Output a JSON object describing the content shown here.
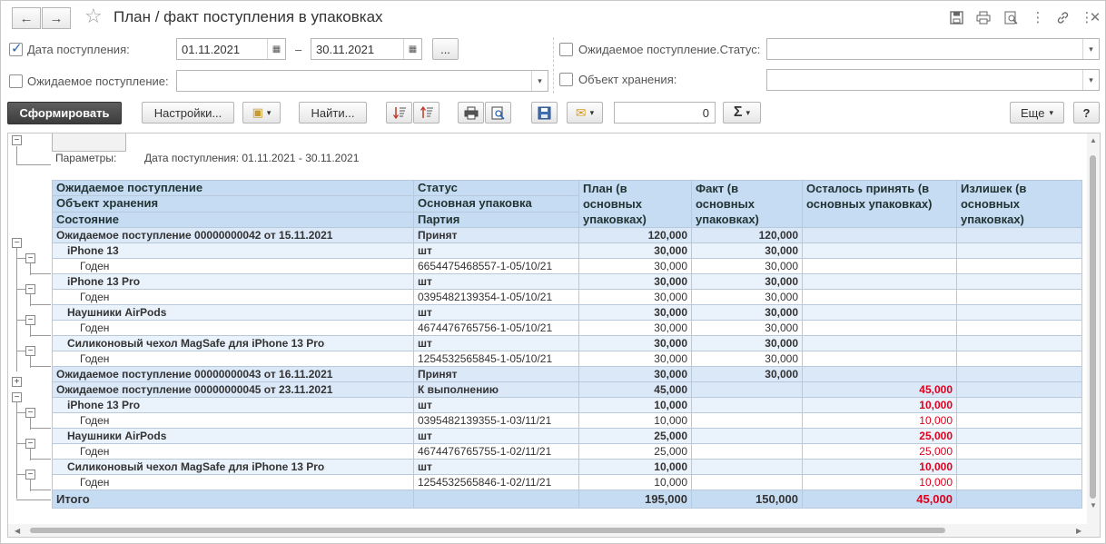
{
  "window": {
    "title": "План / факт поступления в упаковках",
    "back_icon": "←",
    "forward_icon": "→"
  },
  "filters": {
    "date_label": "Дата поступления:",
    "date_from": "01.11.2021",
    "date_dash": "–",
    "date_to": "30.11.2021",
    "period_button": "...",
    "expected_label": "Ожидаемое поступление:",
    "expected_value": "",
    "status_label": "Ожидаемое поступление.Статус:",
    "status_value": "",
    "storage_label": "Объект хранения:",
    "storage_value": ""
  },
  "toolbar": {
    "generate": "Сформировать",
    "settings": "Настройки...",
    "find": "Найти...",
    "sum_value": "0",
    "more": "Еще",
    "help": "?"
  },
  "report": {
    "params_label": "Параметры:",
    "params_value": "Дата поступления: 01.11.2021 - 30.11.2021",
    "headers": {
      "c1_1": "Ожидаемое поступление",
      "c1_2": "Объект хранения",
      "c1_3": "Состояние",
      "c2_1": "Статус",
      "c2_2": "Основная упаковка",
      "c2_3": "Партия",
      "c3_1": "План (в",
      "c3_2": "основных",
      "c3_3": "упаковках)",
      "c4_1": "Факт (в",
      "c4_2": "основных",
      "c4_3": "упаковках)",
      "c5_1": "Осталось принять (в",
      "c5_2": "основных упаковках)",
      "c6_1": "Излишек (в",
      "c6_2": "основных",
      "c6_3": "упаковках)"
    },
    "rows": [
      {
        "level": 1,
        "c1": "Ожидаемое поступление 00000000042 от 15.11.2021",
        "c2": "Принят",
        "plan": "120,000",
        "fact": "120,000",
        "remain": "",
        "excess": ""
      },
      {
        "level": 2,
        "c1": "iPhone 13",
        "c2": "шт",
        "plan": "30,000",
        "fact": "30,000",
        "remain": "",
        "excess": ""
      },
      {
        "level": 3,
        "c1": "Годен",
        "c2": "6654475468557-1-05/10/21",
        "plan": "30,000",
        "fact": "30,000",
        "remain": "",
        "excess": ""
      },
      {
        "level": 2,
        "c1": "iPhone 13 Pro",
        "c2": "шт",
        "plan": "30,000",
        "fact": "30,000",
        "remain": "",
        "excess": ""
      },
      {
        "level": 3,
        "c1": "Годен",
        "c2": "0395482139354-1-05/10/21",
        "plan": "30,000",
        "fact": "30,000",
        "remain": "",
        "excess": ""
      },
      {
        "level": 2,
        "c1": "Наушники AirPods",
        "c2": "шт",
        "plan": "30,000",
        "fact": "30,000",
        "remain": "",
        "excess": ""
      },
      {
        "level": 3,
        "c1": "Годен",
        "c2": "4674476765756-1-05/10/21",
        "plan": "30,000",
        "fact": "30,000",
        "remain": "",
        "excess": ""
      },
      {
        "level": 2,
        "c1": "Силиконовый чехол MagSafe для iPhone 13 Pro",
        "c2": "шт",
        "plan": "30,000",
        "fact": "30,000",
        "remain": "",
        "excess": ""
      },
      {
        "level": 3,
        "c1": "Годен",
        "c2": "1254532565845-1-05/10/21",
        "plan": "30,000",
        "fact": "30,000",
        "remain": "",
        "excess": ""
      },
      {
        "level": 1,
        "c1": "Ожидаемое поступление 00000000043 от 16.11.2021",
        "c2": "Принят",
        "plan": "30,000",
        "fact": "30,000",
        "remain": "",
        "excess": ""
      },
      {
        "level": 1,
        "c1": "Ожидаемое поступление 00000000045 от 23.11.2021",
        "c2": "К выполнению",
        "plan": "45,000",
        "fact": "",
        "remain": "45,000",
        "excess": ""
      },
      {
        "level": 2,
        "c1": "iPhone 13 Pro",
        "c2": "шт",
        "plan": "10,000",
        "fact": "",
        "remain": "10,000",
        "excess": ""
      },
      {
        "level": 3,
        "c1": "Годен",
        "c2": "0395482139355-1-03/11/21",
        "plan": "10,000",
        "fact": "",
        "remain": "10,000",
        "excess": ""
      },
      {
        "level": 2,
        "c1": "Наушники AirPods",
        "c2": "шт",
        "plan": "25,000",
        "fact": "",
        "remain": "25,000",
        "excess": ""
      },
      {
        "level": 3,
        "c1": "Годен",
        "c2": "4674476765755-1-02/11/21",
        "plan": "25,000",
        "fact": "",
        "remain": "25,000",
        "excess": ""
      },
      {
        "level": 2,
        "c1": "Силиконовый чехол MagSafe для iPhone 13 Pro",
        "c2": "шт",
        "plan": "10,000",
        "fact": "",
        "remain": "10,000",
        "excess": ""
      },
      {
        "level": 3,
        "c1": "Годен",
        "c2": "1254532565846-1-02/11/21",
        "plan": "10,000",
        "fact": "",
        "remain": "10,000",
        "excess": ""
      }
    ],
    "total": {
      "label": "Итого",
      "plan": "195,000",
      "fact": "150,000",
      "remain": "45,000"
    }
  },
  "colors": {
    "header_bg": "#c6dcf3",
    "group_bg": "#dbe8f7",
    "subgroup_bg": "#eaf2fb",
    "remain_red": "#e0001b"
  }
}
